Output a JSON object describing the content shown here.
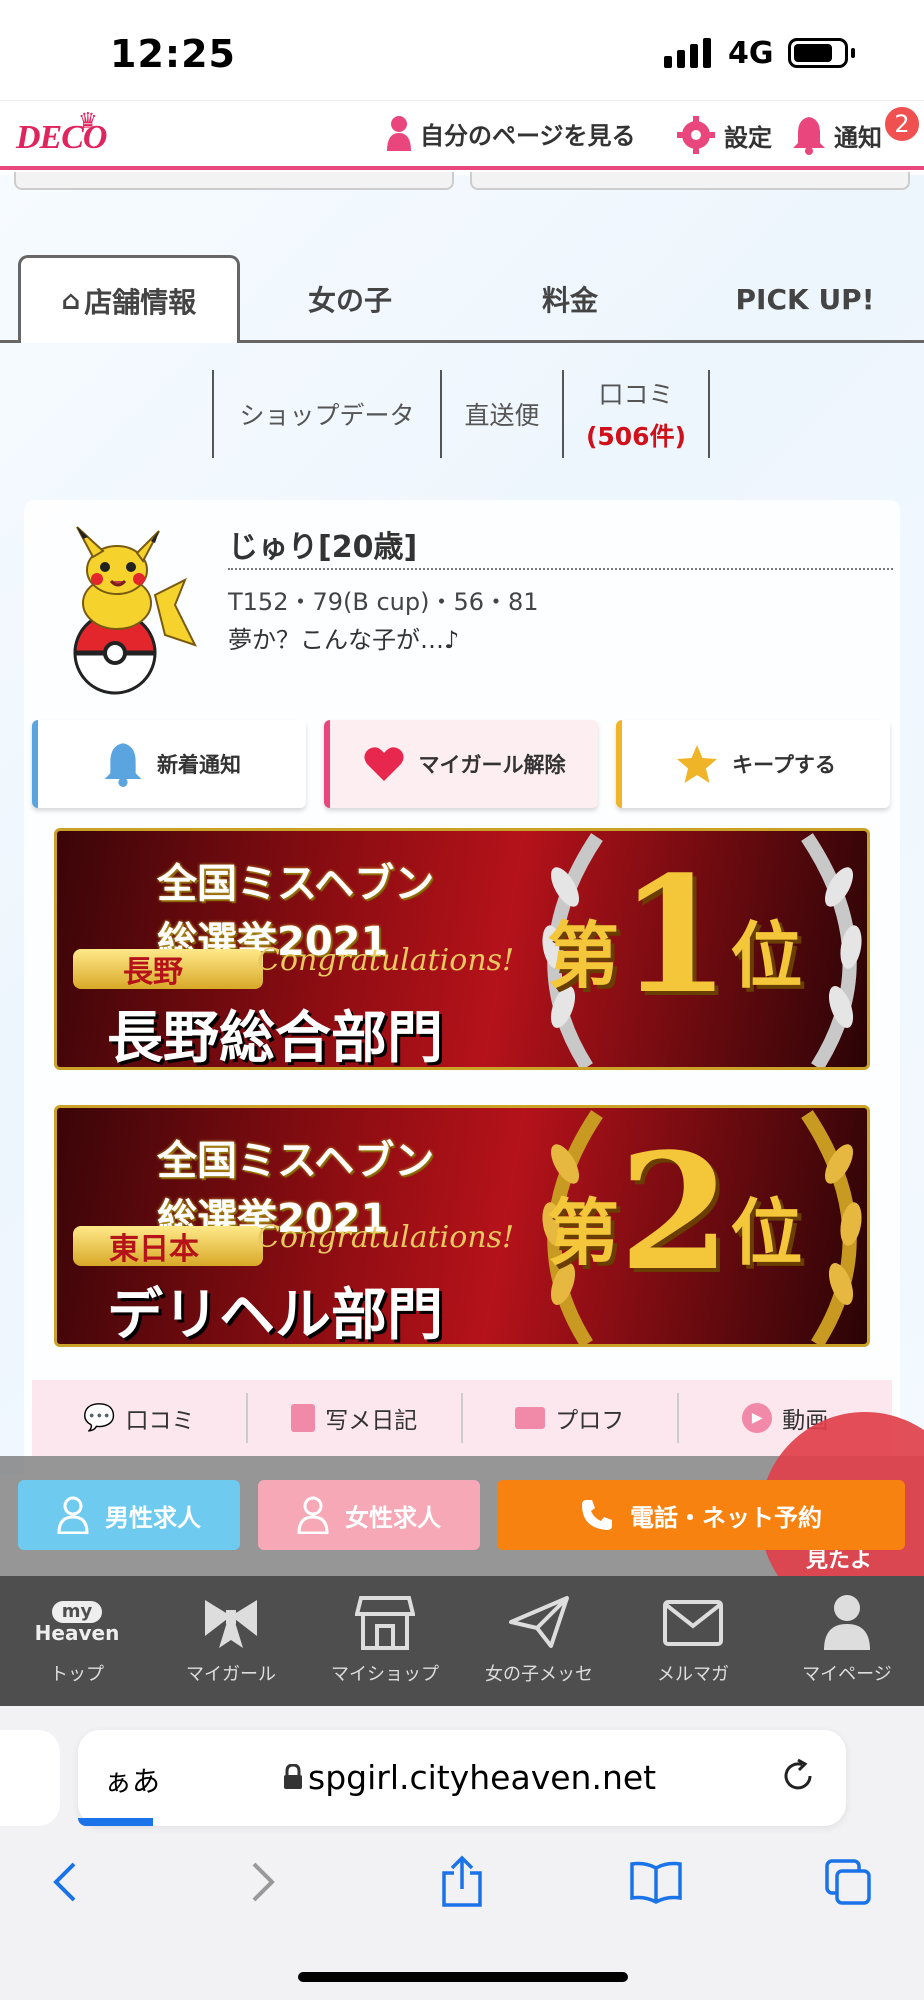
{
  "status_bar": {
    "time": "12:25",
    "network": "4G"
  },
  "header": {
    "logo": "DECO",
    "my_page": "自分のページを見る",
    "settings": "設定",
    "notifications": "通知",
    "notification_count": "2"
  },
  "tabs": [
    {
      "label": "店舗情報",
      "active": true
    },
    {
      "label": "女の子"
    },
    {
      "label": "料金"
    },
    {
      "label": "PICK UP!"
    }
  ],
  "subnav": {
    "shop_data": "ショップデータ",
    "direct": "直送便",
    "reviews": "口コミ",
    "reviews_count": "(506件)"
  },
  "profile": {
    "name": "じゅり[20歳]",
    "measurements": "T152・79(B cup)・56・81",
    "catchphrase": "夢か？こんな子が…♪"
  },
  "actions": {
    "notify": "新着通知",
    "unfavorite": "マイガール解除",
    "keep": "キープする"
  },
  "banners": [
    {
      "title_line1": "全国ミスヘブン",
      "title_line2": "総選挙2021",
      "region": "長野",
      "congrats": "Congratulations!",
      "category": "長野総合部門",
      "rank_prefix": "第",
      "rank_number": "1",
      "rank_suffix": "位"
    },
    {
      "title_line1": "全国ミスヘブン",
      "title_line2": "総選挙2021",
      "region": "東日本",
      "congrats": "Congratulations!",
      "category": "デリヘル部門",
      "rank_prefix": "第",
      "rank_number": "2",
      "rank_suffix": "位"
    }
  ],
  "content_tabs": {
    "reviews": "口コミ",
    "diary": "写メ日記",
    "profile": "プロフ",
    "video": "動画"
  },
  "floating": {
    "male_jobs": "男性求人",
    "female_jobs": "女性求人",
    "reserve": "電話・ネット予約",
    "fab_text": "見たよ"
  },
  "tab_bar": {
    "logo_top": "my",
    "logo_bottom": "Heaven",
    "items": [
      {
        "label": "トップ",
        "icon": "heaven-logo-icon"
      },
      {
        "label": "マイガール",
        "icon": "ribbon-icon"
      },
      {
        "label": "マイショップ",
        "icon": "shop-icon"
      },
      {
        "label": "女の子メッセ",
        "icon": "paper-plane-icon"
      },
      {
        "label": "メルマガ",
        "icon": "mail-icon"
      },
      {
        "label": "マイページ",
        "icon": "person-icon"
      }
    ]
  },
  "browser": {
    "aa": "ぁあ",
    "url": "spgirl.cityheaven.net"
  },
  "colors": {
    "brand_pink": "#e8467c",
    "reserve_orange": "#f7820f",
    "male_blue": "#6ecbef",
    "female_pink": "#f7a8b6"
  }
}
